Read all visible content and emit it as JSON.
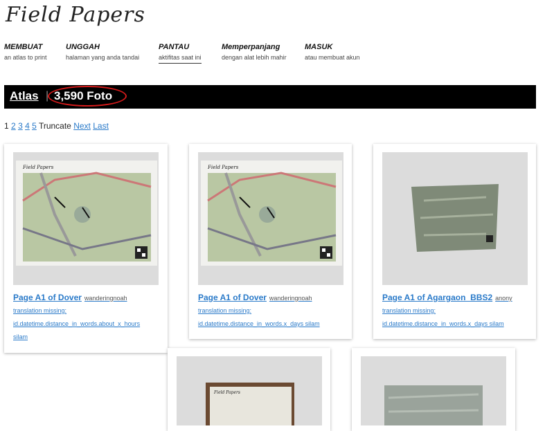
{
  "logo": "Field Papers",
  "nav": [
    {
      "title": "MEMBUAT",
      "sub": "an atlas to print"
    },
    {
      "title": "UNGGAH",
      "sub": "halaman yang anda tandai"
    },
    {
      "title": "PANTAU",
      "sub": "aktifitas saat ini"
    },
    {
      "title": "Memperpanjang",
      "sub": "dengan alat lebih mahir"
    },
    {
      "title": "MASUK",
      "sub": "atau membuat akun"
    }
  ],
  "header": {
    "atlas": "Atlas",
    "separator": "|",
    "count": "3,590 Foto"
  },
  "pager": {
    "current": "1",
    "pages": [
      "2",
      "3",
      "4",
      "5"
    ],
    "truncate": "Truncate",
    "next": "Next",
    "last": "Last"
  },
  "cards": [
    {
      "title": "Page A1 of Dover",
      "user": "wanderingnoah",
      "line1": "translation missing:",
      "line2": "id.datetime.distance_in_words.about_x_hours",
      "line3": "silam"
    },
    {
      "title": "Page A1 of Dover",
      "user": "wanderingnoah",
      "line1": "translation missing:",
      "line2": "id.datetime.distance_in_words.x_days silam"
    },
    {
      "title": "Page A1 of Agargaon_BBS2",
      "user": "anony",
      "line1": "translation missing:",
      "line2": "id.datetime.distance_in_words.x_days silam"
    }
  ],
  "thumb_small_title": "Field Papers"
}
